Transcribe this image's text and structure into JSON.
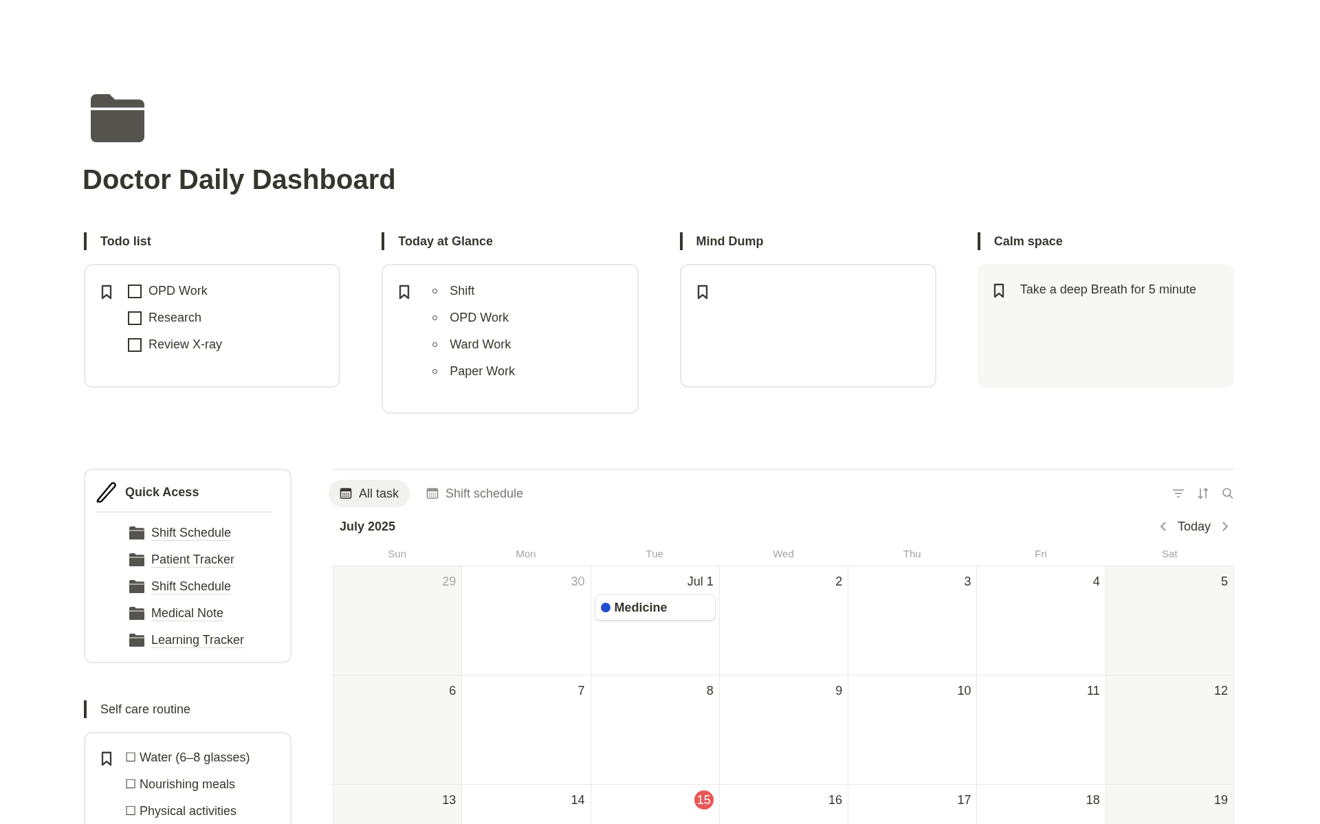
{
  "page": {
    "title": "Doctor Daily Dashboard"
  },
  "widgets": [
    {
      "heading": "Todo list",
      "kind": "todo",
      "items": [
        {
          "text": "OPD Work",
          "checked": false
        },
        {
          "text": "Research",
          "checked": false
        },
        {
          "text": "Review X-ray",
          "checked": false
        }
      ]
    },
    {
      "heading": "Today at Glance",
      "kind": "bullets",
      "items": [
        {
          "text": "Shift"
        },
        {
          "text": "OPD Work"
        },
        {
          "text": "Ward Work"
        },
        {
          "text": "Paper Work"
        }
      ]
    },
    {
      "heading": "Mind Dump",
      "kind": "empty"
    },
    {
      "heading": "Calm space",
      "kind": "note",
      "items": [
        {
          "text": "Take a deep Breath for 5 minute"
        }
      ]
    }
  ],
  "quick_access": {
    "title": "Quick Acess",
    "links": [
      "Shift Schedule",
      "Patient Tracker",
      "Shift Schedule",
      "Medical Note",
      "Learning Tracker"
    ]
  },
  "self_care": {
    "heading": "Self care routine",
    "items": [
      "☐ Water (6–8 glasses)",
      "☐ Nourishing meals",
      "☐ Physical activities"
    ]
  },
  "calendar": {
    "tabs": [
      {
        "label": "All task",
        "selected": true
      },
      {
        "label": "Shift schedule",
        "selected": false
      }
    ],
    "month": "July 2025",
    "today_button": "Today",
    "weekdays": [
      "Sun",
      "Mon",
      "Tue",
      "Wed",
      "Thu",
      "Fri",
      "Sat"
    ],
    "weeks": [
      [
        {
          "day": "29",
          "muted": true
        },
        {
          "day": "30",
          "muted": true
        },
        {
          "day": "Jul 1",
          "muted": false,
          "events": [
            {
              "title": "Medicine",
              "color": "#1f4fcf"
            }
          ]
        },
        {
          "day": "2",
          "muted": false
        },
        {
          "day": "3",
          "muted": false
        },
        {
          "day": "4",
          "muted": false
        },
        {
          "day": "5",
          "muted": false
        }
      ],
      [
        {
          "day": "6",
          "muted": false
        },
        {
          "day": "7",
          "muted": false
        },
        {
          "day": "8",
          "muted": false
        },
        {
          "day": "9",
          "muted": false
        },
        {
          "day": "10",
          "muted": false
        },
        {
          "day": "11",
          "muted": false
        },
        {
          "day": "12",
          "muted": false
        }
      ],
      [
        {
          "day": "13",
          "muted": false
        },
        {
          "day": "14",
          "muted": false
        },
        {
          "day": "15",
          "muted": false,
          "today": true
        },
        {
          "day": "16",
          "muted": false
        },
        {
          "day": "17",
          "muted": false
        },
        {
          "day": "18",
          "muted": false
        },
        {
          "day": "19",
          "muted": false
        }
      ]
    ]
  }
}
